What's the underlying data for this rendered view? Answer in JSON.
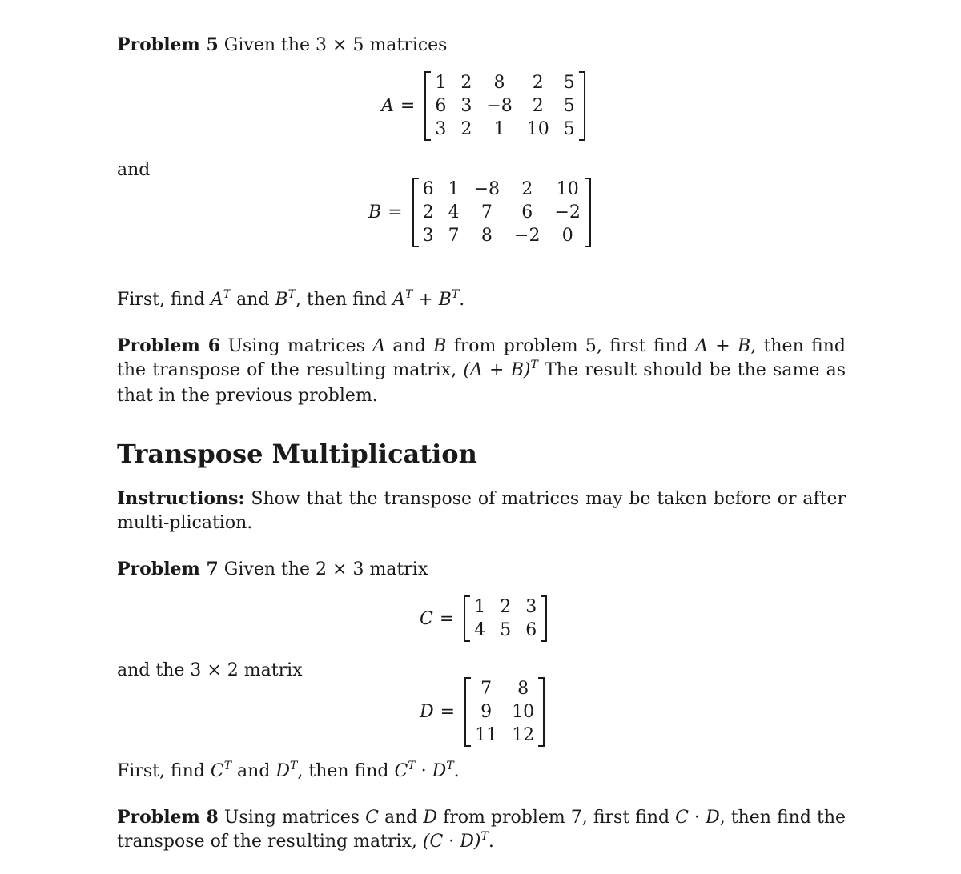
{
  "problem5": {
    "label": "Problem 5",
    "intro": "Given the 3 × 5 matrices",
    "connector": "and",
    "matrix_A": {
      "name": "A",
      "eq": "=",
      "rows": [
        [
          "1",
          "2",
          "8",
          "2",
          "5"
        ],
        [
          "6",
          "3",
          "−8",
          "2",
          "5"
        ],
        [
          "3",
          "2",
          "1",
          "10",
          "5"
        ]
      ]
    },
    "matrix_B": {
      "name": "B",
      "eq": "=",
      "rows": [
        [
          "6",
          "1",
          "−8",
          "2",
          "10"
        ],
        [
          "2",
          "4",
          "7",
          "6",
          "−2"
        ],
        [
          "3",
          "7",
          "8",
          "−2",
          "0"
        ]
      ]
    },
    "task": {
      "p1": "First, find ",
      "A": "A",
      "T": "T",
      "p2": " and ",
      "B": "B",
      "p3": ", then find ",
      "plus": " + ",
      "end": "."
    }
  },
  "problem6": {
    "label": "Problem 6",
    "t1": "Using matrices ",
    "A": "A",
    "t2": " and ",
    "B": "B",
    "t3": " from problem 5, first find ",
    "sum": "A + B",
    "t4": ", then find the transpose of the resulting matrix, ",
    "expr": "(A + B)",
    "T": "T",
    "t5": " The result should be the same as that in the previous problem."
  },
  "section": {
    "title": "Transpose Multiplication",
    "instructions_label": "Instructions:",
    "instructions_text": "Show that the transpose of matrices may be taken before or after multi-plication."
  },
  "problem7": {
    "label": "Problem 7",
    "intro": "Given the 2 × 3 matrix",
    "connector": "and the 3 × 2 matrix",
    "matrix_C": {
      "name": "C",
      "eq": "=",
      "rows": [
        [
          "1",
          "2",
          "3"
        ],
        [
          "4",
          "5",
          "6"
        ]
      ]
    },
    "matrix_D": {
      "name": "D",
      "eq": "=",
      "rows": [
        [
          "7",
          "8"
        ],
        [
          "9",
          "10"
        ],
        [
          "11",
          "12"
        ]
      ]
    },
    "task": {
      "p1": "First, find ",
      "C": "C",
      "T": "T",
      "p2": " and ",
      "D": "D",
      "p3": ", then find ",
      "dot": " · ",
      "end": "."
    }
  },
  "problem8": {
    "label": "Problem 8",
    "t1": "Using matrices ",
    "C": "C",
    "t2": " and ",
    "D": "D",
    "t3": " from problem 7, first find ",
    "prod": "C · D",
    "t4": ", then find the transpose of the resulting matrix, ",
    "expr": "(C · D)",
    "T": "T",
    "end": "."
  }
}
